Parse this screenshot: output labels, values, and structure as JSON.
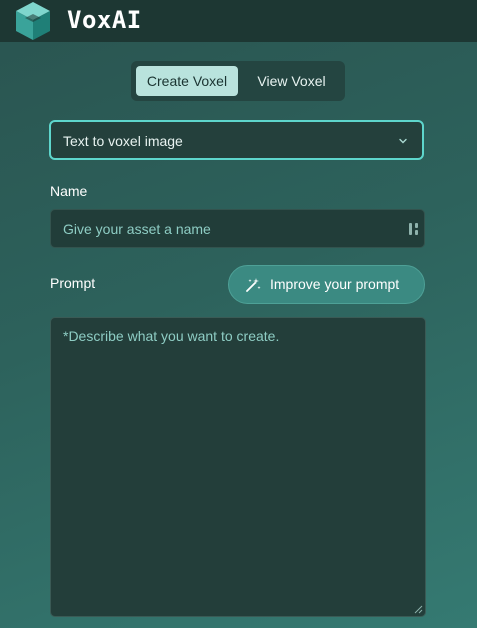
{
  "app": {
    "brand": "VoxAI"
  },
  "tabs": [
    {
      "label": "Create Voxel",
      "active": true
    },
    {
      "label": "View Voxel",
      "active": false
    }
  ],
  "mode_select": {
    "value": "Text to voxel image",
    "icon": "chevron-down-icon"
  },
  "name_field": {
    "label": "Name",
    "value": "",
    "placeholder": "Give your asset a name"
  },
  "prompt": {
    "label": "Prompt",
    "improve_label": "Improve your prompt",
    "value": "",
    "placeholder": "*Describe what you want to create."
  },
  "colors": {
    "accent": "#5ed6cc",
    "active_tab": "#b9e3dd",
    "button": "#3b8a82",
    "topbar": "#1d3733"
  }
}
